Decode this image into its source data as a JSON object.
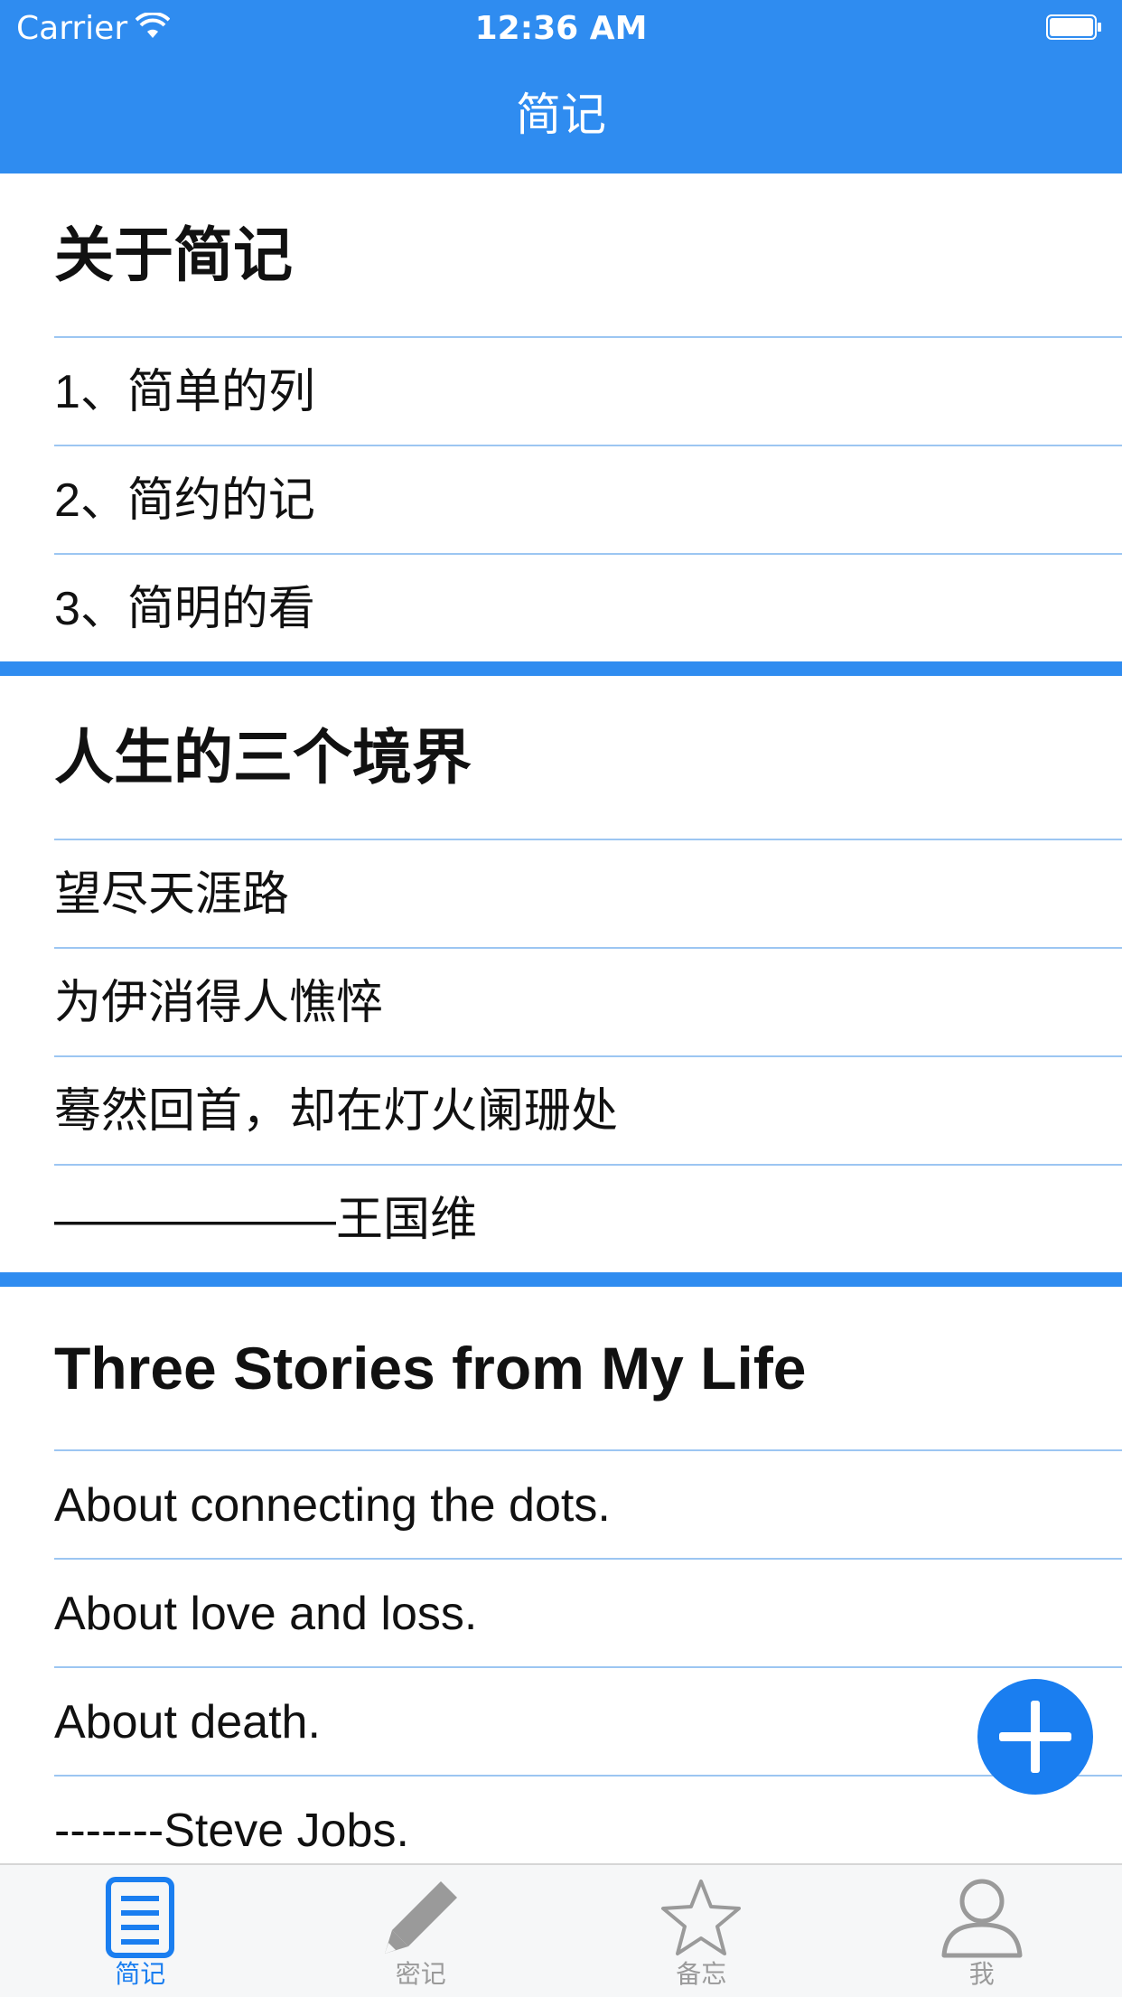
{
  "status_bar": {
    "carrier": "Carrier",
    "time": "12:36 AM"
  },
  "nav": {
    "title": "简记"
  },
  "sections": [
    {
      "title": "关于简记",
      "rows": [
        "1、简单的列",
        "2、简约的记",
        "3、简明的看"
      ]
    },
    {
      "title": "人生的三个境界",
      "rows": [
        "望尽天涯路",
        "为伊消得人憔悴",
        "蓦然回首，却在灯火阑珊处",
        "——————王国维"
      ]
    },
    {
      "title": "Three Stories from My Life",
      "rows": [
        "About connecting the dots.",
        "About love and loss.",
        "About death.",
        "-------Steve Jobs."
      ]
    }
  ],
  "fab": {
    "icon": "plus-icon"
  },
  "tabs": [
    {
      "label": "简记",
      "icon": "note-list-icon",
      "active": true
    },
    {
      "label": "密记",
      "icon": "pencil-icon",
      "active": false
    },
    {
      "label": "备忘",
      "icon": "star-icon",
      "active": false
    },
    {
      "label": "我",
      "icon": "person-icon",
      "active": false
    }
  ],
  "colors": {
    "accent": "#2f8cf0",
    "separator": "#9cc6f2",
    "tab_inactive": "#9a9a9a"
  }
}
